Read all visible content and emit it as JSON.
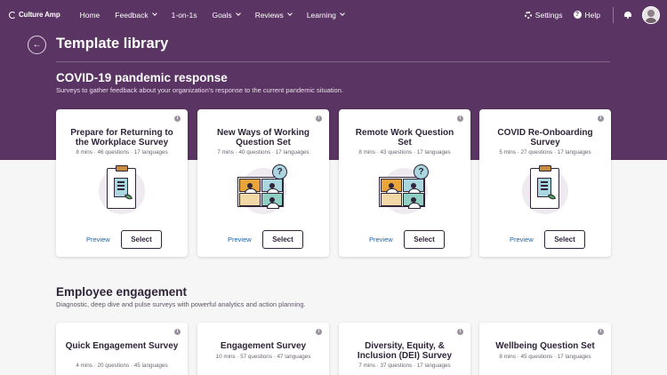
{
  "nav": {
    "brand": "Culture Amp",
    "items": [
      {
        "label": "Home",
        "dropdown": false
      },
      {
        "label": "Feedback",
        "dropdown": true
      },
      {
        "label": "1-on-1s",
        "dropdown": false
      },
      {
        "label": "Goals",
        "dropdown": true
      },
      {
        "label": "Reviews",
        "dropdown": true
      },
      {
        "label": "Learning",
        "dropdown": true
      }
    ],
    "settings": "Settings",
    "help": "Help",
    "help_glyph": "?"
  },
  "colors": {
    "header_bg": "#5a3462",
    "link": "#1b64a6",
    "text": "#2f2438"
  },
  "page": {
    "back_glyph": "←",
    "title": "Template library"
  },
  "sections": [
    {
      "title": "COVID-19 pandemic response",
      "subtitle": "Surveys to gather feedback about your organization’s response to the current pandemic situation.",
      "cards": [
        {
          "title": "Prepare for Returning to the Workplace Survey",
          "meta": "8 mins · 46 questions · 17 languages",
          "illustration": "clipboard",
          "preview": "Preview",
          "select": "Select"
        },
        {
          "title": "New Ways of Working Question Set",
          "meta": "7 mins · 40 questions · 17 languages",
          "illustration": "video-call",
          "preview": "Preview",
          "select": "Select"
        },
        {
          "title": "Remote Work Question Set",
          "meta": "8 mins · 43 questions · 17 languages",
          "illustration": "video-call",
          "preview": "Preview",
          "select": "Select"
        },
        {
          "title": "COVID Re-Onboarding Survey",
          "meta": "5 mins · 27 questions · 17 languages",
          "illustration": "clipboard",
          "preview": "Preview",
          "select": "Select"
        }
      ]
    },
    {
      "title": "Employee engagement",
      "subtitle": "Diagnostic, deep dive and pulse surveys with powerful analytics and action planning.",
      "cards": [
        {
          "title": "Quick Engagement Survey",
          "meta": "4 mins · 20 questions · 45 languages"
        },
        {
          "title": "Engagement Survey",
          "meta": "10 mins · 57 questions · 47 languages"
        },
        {
          "title": "Diversity, Equity, & Inclusion (DEI) Survey",
          "meta": "7 mins · 37 questions · 17 languages"
        },
        {
          "title": "Wellbeing Question Set",
          "meta": "8 mins · 45 questions · 17 languages"
        }
      ]
    }
  ],
  "info_glyph": "i"
}
